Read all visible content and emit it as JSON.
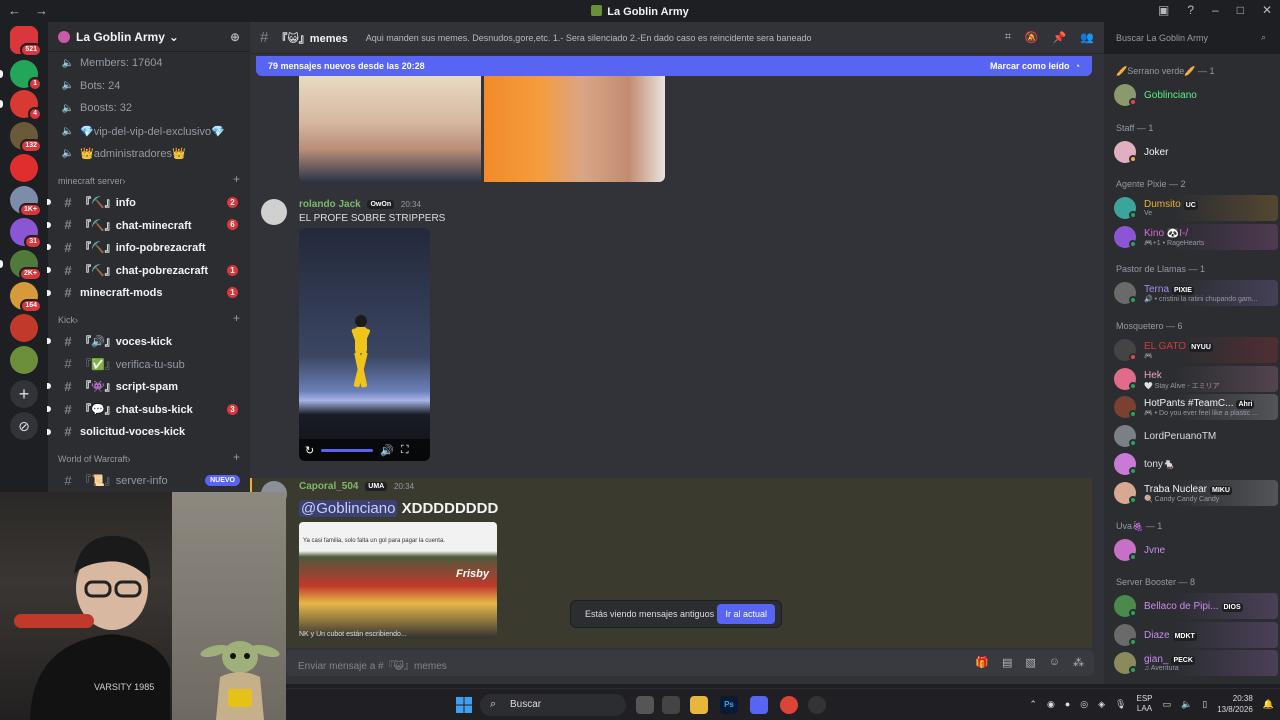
{
  "window": {
    "title": "La Goblin Army",
    "nav_back": "←",
    "nav_forward": "→"
  },
  "servers": [
    {
      "badge": "521",
      "color": "#da373c"
    },
    {
      "badge": "1",
      "color": "#23a55a"
    },
    {
      "badge": "4",
      "color": "#d63a32"
    },
    {
      "badge": "132",
      "color": "#6b5a3a"
    },
    {
      "badge": "",
      "color": "#e02d2d"
    },
    {
      "badge": "1K+",
      "color": "#7b8da8"
    },
    {
      "badge": "31",
      "color": "#8a56d6"
    },
    {
      "badge": "2K+",
      "color": "#4f7a3a"
    },
    {
      "badge": "164",
      "color": "#d69a3a"
    },
    {
      "badge": "",
      "color": "#c0392b"
    },
    {
      "badge": "",
      "color": "#6b8f3a"
    }
  ],
  "sidebar": {
    "server_name": "La Goblin Army",
    "stats": [
      "Members: 17604",
      "Bots: 24",
      "Boosts: 32",
      "💎vip-del-vip-del-exclusivo💎",
      "👑administradores👑"
    ],
    "categories": [
      {
        "name": "minecraft server",
        "channels": [
          {
            "label": "『⛏️』info",
            "count": "2",
            "bold": true
          },
          {
            "label": "『⛏️』chat-minecraft",
            "count": "6",
            "bold": true
          },
          {
            "label": "『⛏️』info-pobrezacraft",
            "count": "",
            "bold": true
          },
          {
            "label": "『⛏️』chat-pobrezacraft",
            "count": "1",
            "bold": true
          },
          {
            "label": "minecraft-mods",
            "count": "1",
            "bold": true
          }
        ]
      },
      {
        "name": "Kick",
        "channels": [
          {
            "label": "『🔊』voces-kick",
            "count": "",
            "bold": true
          },
          {
            "label": "『✅』verifica-tu-sub",
            "count": "",
            "bold": false
          },
          {
            "label": "『👾』script-spam",
            "count": "",
            "bold": true
          },
          {
            "label": "『💬』chat-subs-kick",
            "count": "3",
            "bold": true
          },
          {
            "label": "solicitud-voces-kick",
            "count": "",
            "bold": true
          }
        ]
      },
      {
        "name": "World of Warcraft",
        "channels": [
          {
            "label": "『📜』server-info",
            "badge": "NUEVO"
          }
        ]
      }
    ]
  },
  "channel": {
    "name": "『😺』memes",
    "topic": "Aqui manden sus memes. Desnudos,gore,etc. 1.- Sera silenciado 2.-En dado caso es reincidente sera baneado",
    "search_placeholder": "Buscar La Goblin Army"
  },
  "new_messages_bar": {
    "text": "79 mensajes nuevos desde las 20:28",
    "action": "Marcar como leído"
  },
  "messages": [
    {
      "author": "rolando Jack",
      "author_color": "#7fb86a",
      "tag": "OwOn",
      "time": "20:34",
      "text": "EL PROFE SOBRE STRIPPERS"
    },
    {
      "author": "Caporal_504",
      "author_color": "#7fb86a",
      "tag": "UMA",
      "time": "20:34",
      "mention": "@Goblinciano",
      "text": "XDDDDDDDD",
      "embed_caption": "Ya casi familia, solo falta un gol para pagar la cuenta.",
      "embed_sign": "Frisby"
    }
  ],
  "typing": {
    "text": "NK y Un cubot están escribiendo..."
  },
  "old_messages_bar": {
    "text": "Estás viendo mensajes antiguos",
    "action": "Ir al actual"
  },
  "composer": {
    "placeholder": "Enviar mensaje a #『😺』memes"
  },
  "members": {
    "groups": [
      {
        "title": "🥖Serrano verde🥖 — 1",
        "people": [
          {
            "name": "Goblinciano",
            "color": "#57f287",
            "status": "dnd",
            "tag": "",
            "sub": ""
          }
        ]
      },
      {
        "title": "Staff — 1",
        "people": [
          {
            "name": "Joker",
            "color": "#f2f3f5",
            "status": "idle",
            "tag": "",
            "sub": ""
          }
        ]
      },
      {
        "title": "Agente Pixie — 2",
        "people": [
          {
            "name": "Dumsito",
            "color": "#f0b232",
            "status": "online",
            "tag": "UC",
            "sub": "Ve"
          },
          {
            "name": "Kino 🐼I-/",
            "color": "#e06bd4",
            "status": "online",
            "tag": "",
            "sub": "🎮+1 • RageHearts"
          }
        ]
      },
      {
        "title": "Pastor de Llamas — 1",
        "people": [
          {
            "name": "Terna",
            "color": "#a98bf2",
            "status": "online",
            "tag": "PIXIE",
            "sub": "🔊 • cristini la ratini chupando gam..."
          }
        ]
      },
      {
        "title": "Mosquetero — 6",
        "people": [
          {
            "name": "EL GATO",
            "color": "#da373c",
            "status": "dnd",
            "tag": "NYUU",
            "sub": "🎮"
          },
          {
            "name": "Hek",
            "color": "#f2a0c8",
            "status": "online",
            "tag": "",
            "sub": "🤍 Stay Alive - エミリア"
          },
          {
            "name": "HotPants #TeamC...",
            "color": "#f2f3f5",
            "status": "online",
            "tag": "Ahri",
            "sub": "🎮 • Do you ever feel like a plastic ..."
          },
          {
            "name": "LordPeruanoTM",
            "color": "#dbdee1",
            "status": "online",
            "tag": "",
            "sub": ""
          },
          {
            "name": "tony🐁",
            "color": "#dbdee1",
            "status": "online",
            "tag": "",
            "sub": ""
          },
          {
            "name": "Traba Nuclear",
            "color": "#f2f3f5",
            "status": "online",
            "tag": "MIKU",
            "sub": "🍭 Candy Candy Candy"
          }
        ]
      },
      {
        "title": "Uva🍇 — 1",
        "people": [
          {
            "name": "Jvne",
            "color": "#c98bf2",
            "status": "online",
            "tag": "",
            "sub": ""
          }
        ]
      },
      {
        "title": "Server Booster — 8",
        "people": [
          {
            "name": "Bellaco de Pipi...",
            "color": "#c98bf2",
            "status": "online",
            "tag": "DIOS",
            "sub": ""
          },
          {
            "name": "Diaze",
            "color": "#c98bf2",
            "status": "online",
            "tag": "MDKT",
            "sub": ""
          },
          {
            "name": "gian_",
            "color": "#c98bf2",
            "status": "online",
            "tag": "PECK",
            "sub": "♫ Aventura"
          }
        ]
      }
    ]
  },
  "taskbar": {
    "search_label": "Buscar",
    "lang_top": "ESP",
    "lang_bottom": "LAA",
    "time": "20:38",
    "date": "13/8/2026"
  },
  "webcam": {
    "shirt_text": "VARSITY 1985"
  }
}
